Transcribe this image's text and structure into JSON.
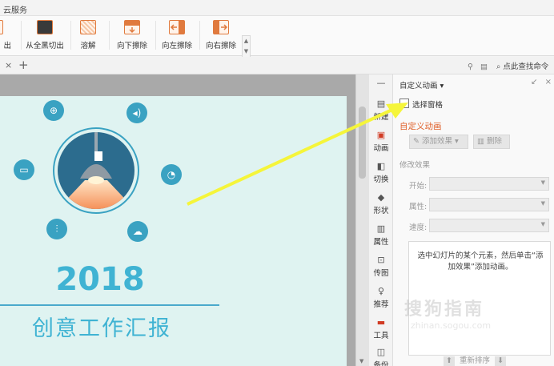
{
  "menu": {
    "cloud_label": "云服务"
  },
  "ribbon": {
    "buttons": [
      {
        "label": "出",
        "icon": "cut-out-icon"
      },
      {
        "label": "从全黑切出",
        "icon": "cut-from-black-icon"
      },
      {
        "label": "溶解",
        "icon": "dissolve-icon"
      },
      {
        "label": "向下擦除",
        "icon": "wipe-down-icon"
      },
      {
        "label": "向左擦除",
        "icon": "wipe-left-icon"
      },
      {
        "label": "向右擦除",
        "icon": "wipe-right-icon"
      }
    ]
  },
  "tabs": {
    "close_glyph": "×",
    "add_glyph": "+"
  },
  "search": {
    "label": "点此查找命令"
  },
  "slide": {
    "year": "2018",
    "subtitle": "创意工作汇报"
  },
  "tools": [
    {
      "label": "新建",
      "icon": "new-icon"
    },
    {
      "label": "动画",
      "icon": "animation-icon"
    },
    {
      "label": "切换",
      "icon": "transition-icon"
    },
    {
      "label": "形状",
      "icon": "shape-icon"
    },
    {
      "label": "属性",
      "icon": "properties-icon"
    },
    {
      "label": "传图",
      "icon": "upload-image-icon"
    },
    {
      "label": "推荐",
      "icon": "recommend-icon"
    },
    {
      "label": "工具",
      "icon": "toolbox-icon"
    },
    {
      "label": "备份",
      "icon": "backup-icon"
    }
  ],
  "panel": {
    "title": "自定义动画",
    "select_pane": "选择窗格",
    "section_title": "自定义动画",
    "add_effect": "添加效果",
    "delete": "删除",
    "modify_title": "修改效果",
    "start_label": "开始:",
    "property_label": "属性:",
    "speed_label": "速度:",
    "hint": "选中幻灯片的某个元素，然后单击“添加效果”添加动画。",
    "reorder": "重新排序"
  },
  "watermark": {
    "main": "搜狗指南",
    "url": "zhinan.sogou.com"
  },
  "colors": {
    "accent": "#e0612b",
    "slide_teal": "#3fb3d3",
    "arrow": "#f5f53a"
  }
}
